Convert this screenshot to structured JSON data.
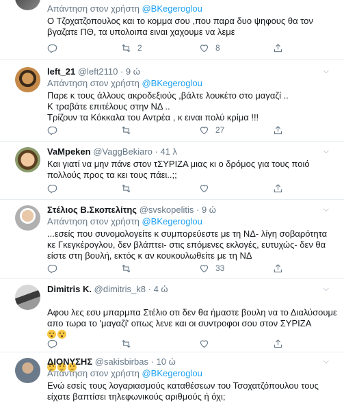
{
  "colors": {
    "accent": "#1da1f2",
    "muted": "#657786",
    "text": "#14171a",
    "divider": "#e6ecf0"
  },
  "tweets": [
    {
      "name": "",
      "handle": "",
      "time": "",
      "reply_prefix": "Απάντηση στον χρήστη",
      "reply_mention": "@BKegeroglou",
      "text": "Ο Τζοχατζοπουλος και το κομμα σου ,που παρα δυο ψηφους θα τον βγαζατε ΠΘ, τα υπολοιπα ειναι χαχουμε να λεμε",
      "replies": "",
      "retweets": "2",
      "likes": "8"
    },
    {
      "name": "left_21",
      "handle": "@left2110",
      "time": "9 ώ",
      "reply_prefix": "Απάντηση στον χρήστη",
      "reply_mention": "@BKegeroglou",
      "text": "Παρε κ τους άλλους ακροδεξιούς ,βάλτε λουκέτο στο μαγαζί ..\nΚ τραβάτε επιτέλους στην ΝΔ ..\nΤρίζουν τα Κόκκαλα του Αντρέα , κ ειναι πολύ κρίμα !!!",
      "replies": "",
      "retweets": "",
      "likes": "27"
    },
    {
      "name": "VaMpeken",
      "handle": "@VaggBekiaro",
      "time": "41 λ",
      "text": "Και γιατί να μην πάνε στον τΣΥΡΙΖΑ μιας κι ο δρόμος για τους ποιό πολλούς προς τα κει τους πάει..;;",
      "replies": "",
      "retweets": "",
      "likes": ""
    },
    {
      "name": "Στέλιος Β.Σκοπελίτης",
      "handle": "@svskopelitis",
      "time": "9 ώ",
      "reply_prefix": "Απάντηση στον χρήστη",
      "reply_mention": "@BKegeroglou",
      "text": "...εσείς που συνομολογείτε κ συμπορεύεστε με τη ΝΔ- λίγη σοβαρότητα κε Γκεγκέρογλου, δεν βλάπτει- στις επόμενες εκλογές, ευτυχώς- δεν θα είστε στη βουλή, εκτός κ αν κουκουλωθείτε με τη ΝΔ",
      "replies": "",
      "retweets": "",
      "likes": "33"
    },
    {
      "name": "Dimitris K.",
      "handle": "@dimitris_k8",
      "time": "4 ώ",
      "text": "Αφου λες εσυ μπαρμπα Στέλιο οτι δεν θα ήμαστε βουλη να το Διαλύσουμε απο τωρα το 'μαγαζί' οπως λενε και οι συντροφοι σου στον ΣΥΡΙΖΑ",
      "replies": "",
      "retweets": "",
      "likes": ""
    },
    {
      "name": "ΔΙΟΝΥΣΗΣ",
      "handle": "@sakisbirbas",
      "time": "10 ώ",
      "reply_prefix": "Απάντηση στον χρήστη",
      "reply_mention": "@BKegeroglou",
      "text": "Ενώ εσείς τους λογαριασμούς καταθέσεων του Τσοχατζόπουλου τους είχατε βαπτίσει τηλεφωνικούς αριθμούς ή όχι;",
      "replies": "",
      "retweets": "",
      "likes": ""
    }
  ],
  "icons": {
    "reply": "reply-icon",
    "retweet": "retweet-icon",
    "like": "heart-icon",
    "share": "share-icon",
    "caret": "chevron-down-icon"
  }
}
